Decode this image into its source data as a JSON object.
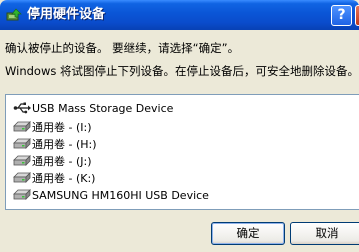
{
  "window": {
    "title": "停用硬件设备",
    "help_label": "?",
    "close_label": "×"
  },
  "message": {
    "line1": "确认被停止的设备。 要继续，请选择“确定”。",
    "line2": "Windows 将试图停止下列设备。在停止设备后，可安全地删除设备。"
  },
  "devices": [
    {
      "label": "USB Mass Storage Device",
      "icon": "usb-icon"
    },
    {
      "label": "通用卷 - (I:)",
      "icon": "drive-icon"
    },
    {
      "label": "通用卷 - (H:)",
      "icon": "drive-icon"
    },
    {
      "label": "通用卷 - (J:)",
      "icon": "drive-icon"
    },
    {
      "label": "通用卷 - (K:)",
      "icon": "drive-icon"
    },
    {
      "label": "SAMSUNG HM160HI USB Device",
      "icon": "drive-icon"
    }
  ],
  "buttons": {
    "ok": "确定",
    "cancel": "取消"
  }
}
